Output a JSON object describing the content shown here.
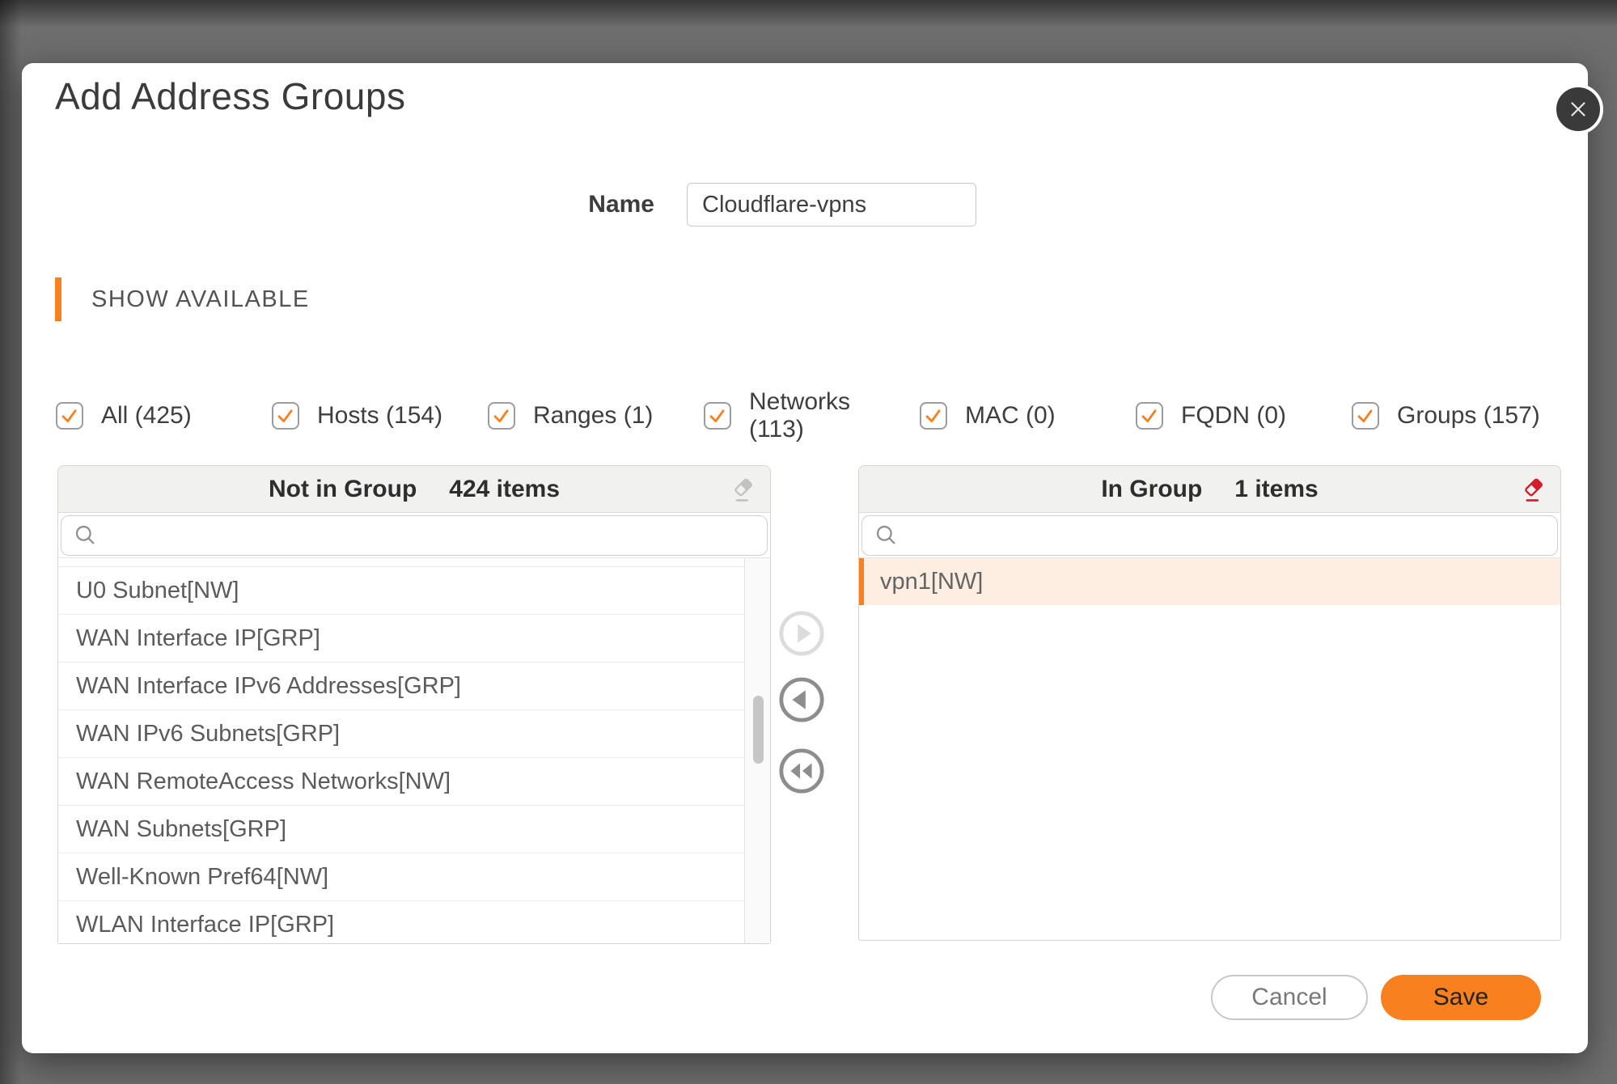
{
  "modal": {
    "title": "Add Address Groups",
    "name_field": {
      "label": "Name",
      "value": "Cloudflare-vpns"
    },
    "section_header": "SHOW AVAILABLE"
  },
  "filters": [
    {
      "label": "All (425)",
      "checked": true
    },
    {
      "label": "Hosts (154)",
      "checked": true
    },
    {
      "label": "Ranges (1)",
      "checked": true
    },
    {
      "label": "Networks (113)",
      "checked": true
    },
    {
      "label": "MAC (0)",
      "checked": true
    },
    {
      "label": "FQDN (0)",
      "checked": true
    },
    {
      "label": "Groups (157)",
      "checked": true
    }
  ],
  "not_in_group": {
    "title": "Not in Group",
    "count": "424 items",
    "search_placeholder": "",
    "items": [
      "U0 Subnet[NW]",
      "WAN Interface IP[GRP]",
      "WAN Interface IPv6 Addresses[GRP]",
      "WAN IPv6 Subnets[GRP]",
      "WAN RemoteAccess Networks[NW]",
      "WAN Subnets[GRP]",
      "Well-Known Pref64[NW]",
      "WLAN Interface IP[GRP]"
    ]
  },
  "in_group": {
    "title": "In Group",
    "count": "1 items",
    "search_placeholder": "",
    "items": [
      "vpn1[NW]"
    ]
  },
  "footer": {
    "cancel": "Cancel",
    "save": "Save"
  },
  "colors": {
    "accent": "#f8801f",
    "selected_row_bg": "#fdeee1",
    "eraser_disabled": "#c2c2c2",
    "eraser_active": "#d21e2b"
  }
}
